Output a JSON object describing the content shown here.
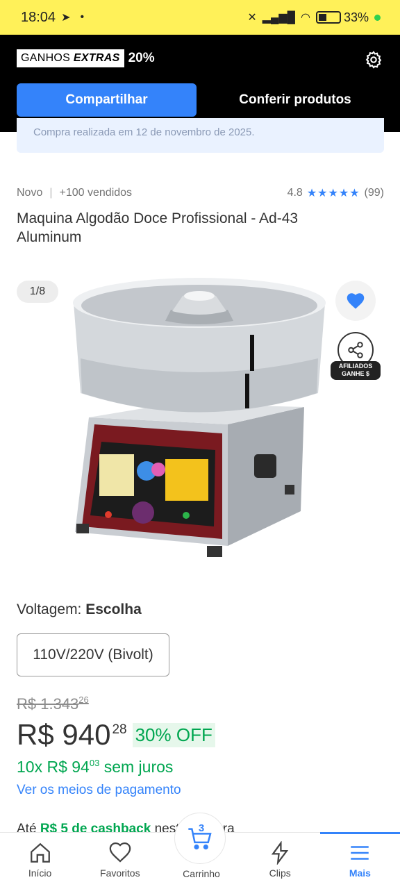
{
  "status_bar": {
    "time": "18:04",
    "battery": "33%"
  },
  "affiliate": {
    "badge_left": "GANHOS",
    "badge_bold": "EXTRAS",
    "badge_pct": "20%",
    "share_label": "Compartilhar",
    "check_label": "Conferir produtos"
  },
  "purchase_note": "Compra realizada em 12 de novembro de 2025.",
  "product": {
    "condition": "Novo",
    "sold": "+100 vendidos",
    "rating": "4.8",
    "stars": "★★★★★",
    "reviews": "(99)",
    "title": "Maquina Algodão Doce Profissional - Ad-43 Aluminum"
  },
  "gallery": {
    "counter": "1/8",
    "affiliate_line1": "AFILIADOS",
    "affiliate_line2": "GANHE $"
  },
  "voltage": {
    "label": "Voltagem: ",
    "value": "Escolha",
    "option": "110V/220V (Bivolt)"
  },
  "price": {
    "old_main": "R$ 1.343",
    "old_cents": "26",
    "main": "R$ 940",
    "cents": "28",
    "discount": "30% OFF",
    "installments_prefix": "10x R$ 94",
    "installments_cents": "03",
    "installments_suffix": " sem juros",
    "payment_link": "Ver os meios de pagamento",
    "cashback_prefix": "Até ",
    "cashback_amount": "R$ 5 de cashback",
    "cashback_suffix": " nesta compra"
  },
  "bottom_nav": {
    "home": "Início",
    "favorites": "Favoritos",
    "cart": "Carrinho",
    "cart_count": "3",
    "clips": "Clips",
    "more": "Mais"
  },
  "colors": {
    "brand_yellow": "#fff159",
    "accent_blue": "#3483fa",
    "discount_green": "#00a650"
  }
}
